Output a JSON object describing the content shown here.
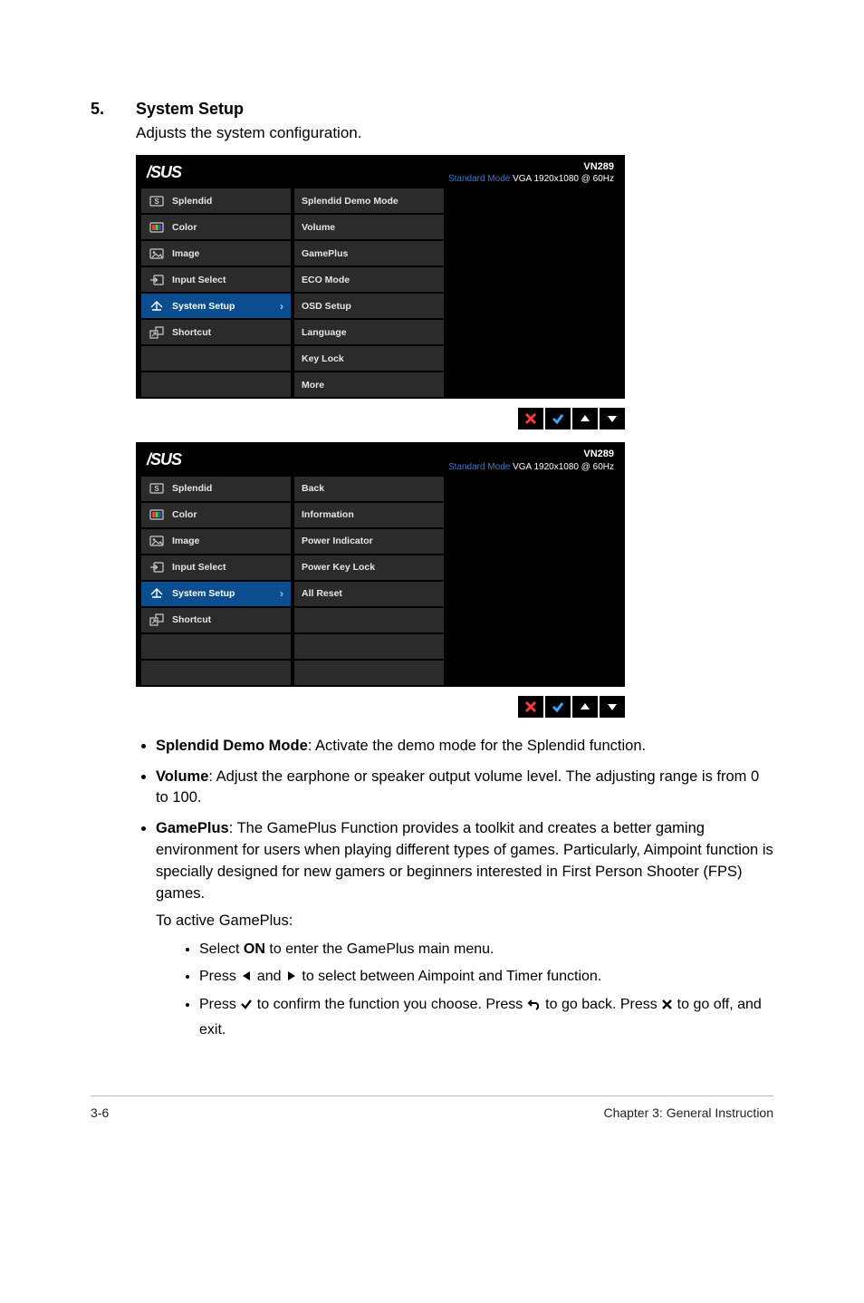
{
  "section": {
    "number": "5.",
    "title": "System Setup",
    "desc": "Adjusts the system configuration."
  },
  "osd_common": {
    "logo": "/SUS",
    "model": "VN289",
    "mode": "Standard Mode",
    "res": "VGA 1920x1080 @ 60Hz"
  },
  "left_menu": [
    {
      "label": "Splendid",
      "icon": "splendid"
    },
    {
      "label": "Color",
      "icon": "color"
    },
    {
      "label": "Image",
      "icon": "image"
    },
    {
      "label": "Input Select",
      "icon": "input"
    },
    {
      "label": "System Setup",
      "icon": "system",
      "selected": true
    },
    {
      "label": "Shortcut",
      "icon": "shortcut"
    }
  ],
  "panel1_mid": [
    "Splendid Demo Mode",
    "Volume",
    "GamePlus",
    "ECO Mode",
    "OSD Setup",
    "Language",
    "Key Lock",
    "More"
  ],
  "panel2_mid": [
    "Back",
    "Information",
    "Power Indicator",
    "Power Key Lock",
    "All Reset",
    "",
    "",
    ""
  ],
  "bullets": {
    "splendid": {
      "name": "Splendid Demo Mode",
      "text": ": Activate the demo mode for the Splendid function."
    },
    "volume": {
      "name": "Volume",
      "text": ": Adjust the earphone or speaker output volume level. The adjusting range is from 0 to 100."
    },
    "gameplus": {
      "name": "GamePlus",
      "text": ": The GamePlus Function provides a toolkit and creates a better gaming environment for users when playing different types of games. Particularly, Aimpoint function is specially designed for new gamers or beginners interested in First Person Shooter (FPS) games.",
      "intro": "To active GamePlus:",
      "subs": {
        "a_pre": "Select ",
        "a_name": "ON",
        "a_post": " to enter the GamePlus main menu.",
        "b_pre": "Press ",
        "b_mid": " and ",
        "b_post": " to select between Aimpoint and Timer function.",
        "c_pre": "Press ",
        "c_mid": " to confirm the function you choose. Press ",
        "c_post": " to go back. Press ",
        "c_end": " to go off, and exit."
      }
    }
  },
  "footer": {
    "left": "3-6",
    "right": "Chapter 3: General Instruction"
  }
}
